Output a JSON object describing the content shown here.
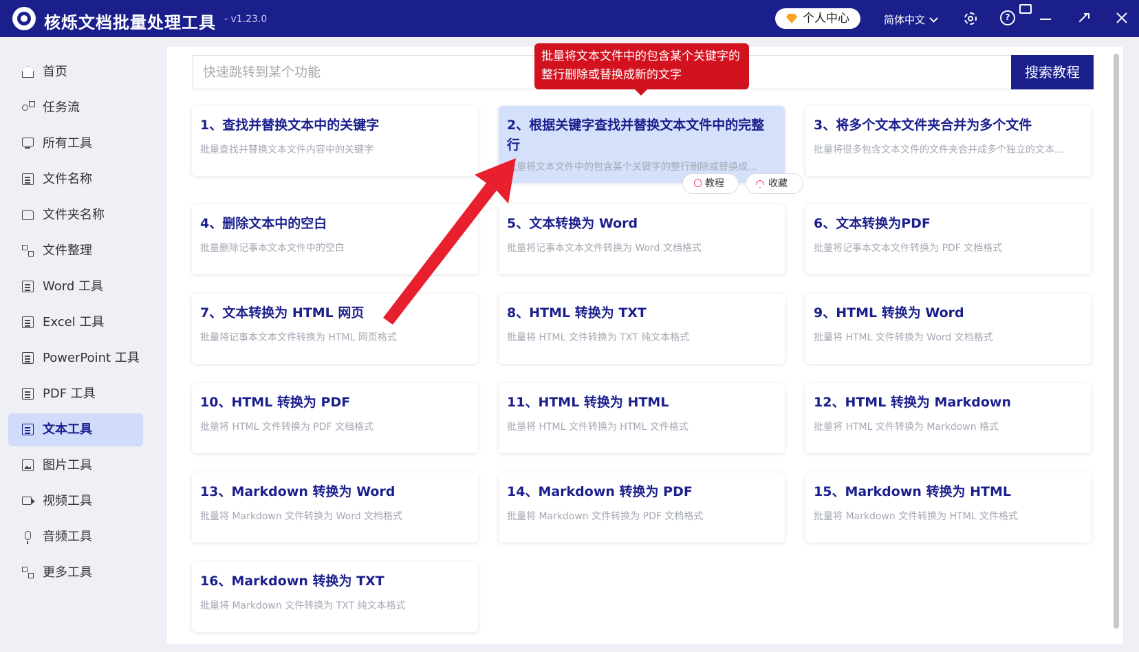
{
  "app": {
    "title": "核烁文档批量处理工具",
    "version": "- v1.23.0"
  },
  "titlebar": {
    "user_center": "个人中心",
    "language": "简体中文",
    "icons": [
      "vip-diamond-icon",
      "gear-icon",
      "help-icon",
      "feedback-icon",
      "minimize-icon",
      "maximize-icon",
      "close-icon"
    ]
  },
  "sidebar": {
    "items": [
      {
        "label": "首页",
        "icon": "home-icon"
      },
      {
        "label": "任务流",
        "icon": "flow-icon"
      },
      {
        "label": "所有工具",
        "icon": "monitor-icon"
      },
      {
        "label": "文件名称",
        "icon": "file-icon"
      },
      {
        "label": "文件夹名称",
        "icon": "folder-icon"
      },
      {
        "label": "文件整理",
        "icon": "organize-icon"
      },
      {
        "label": "Word 工具",
        "icon": "word-icon"
      },
      {
        "label": "Excel 工具",
        "icon": "excel-icon"
      },
      {
        "label": "PowerPoint 工具",
        "icon": "powerpoint-icon"
      },
      {
        "label": "PDF 工具",
        "icon": "pdf-icon"
      },
      {
        "label": "文本工具",
        "icon": "text-icon",
        "active": true
      },
      {
        "label": "图片工具",
        "icon": "image-icon"
      },
      {
        "label": "视频工具",
        "icon": "video-icon"
      },
      {
        "label": "音频工具",
        "icon": "audio-icon"
      },
      {
        "label": "更多工具",
        "icon": "grid-icon"
      }
    ]
  },
  "search": {
    "placeholder": "快速跳转到某个功能",
    "button": "搜索教程"
  },
  "tooltip": "批量将文本文件中的包含某个关键字的整行删除或替换成新的文字",
  "cards": [
    {
      "title": "1、查找并替换文本中的关键字",
      "desc": "批量查找并替换文本文件内容中的关键字"
    },
    {
      "title": "2、根据关键字查找并替换文本文件中的完整行",
      "desc": "批量将文本文件中的包含某个关键字的整行删除或替换成..."
    },
    {
      "title": "3、将多个文本文件夹合并为多个文件",
      "desc": "批量将很多包含文本文件的文件夹合并成多个独立的文本..."
    },
    {
      "title": "4、删除文本中的空白",
      "desc": "批量删除记事本文本文件中的空白"
    },
    {
      "title": "5、文本转换为 Word",
      "desc": "批量将记事本文本文件转换为 Word 文档格式"
    },
    {
      "title": "6、文本转换为PDF",
      "desc": "批量将记事本文本文件转换为 PDF 文档格式"
    },
    {
      "title": "7、文本转换为 HTML 网页",
      "desc": "批量将记事本文本文件转换为 HTML 网页格式"
    },
    {
      "title": "8、HTML 转换为 TXT",
      "desc": "批量将 HTML 文件转换为 TXT 纯文本格式"
    },
    {
      "title": "9、HTML 转换为 Word",
      "desc": "批量将 HTML 文件转换为 Word 文档格式"
    },
    {
      "title": "10、HTML 转换为 PDF",
      "desc": "批量将 HTML 文件转换为 PDF 文档格式"
    },
    {
      "title": "11、HTML 转换为 HTML",
      "desc": "批量将 HTML 文件转换为 HTML 文件格式"
    },
    {
      "title": "12、HTML 转换为 Markdown",
      "desc": "批量将 HTML 文件转换为 Markdown 格式"
    },
    {
      "title": "13、Markdown 转换为 Word",
      "desc": "批量将 Markdown 文件转换为 Word 文档格式"
    },
    {
      "title": "14、Markdown 转换为 PDF",
      "desc": "批量将 Markdown 文件转换为 PDF 文档格式"
    },
    {
      "title": "15、Markdown 转换为 HTML",
      "desc": "批量将 Markdown 文件转换为 HTML 文件格式"
    },
    {
      "title": "16、Markdown 转换为 TXT",
      "desc": "批量将 Markdown 文件转换为 TXT 纯文本格式"
    }
  ],
  "card_actions": {
    "tutorial": "教程",
    "favorite": "收藏"
  },
  "colors": {
    "titlebar": "#1a1f8c",
    "accent": "#1a1f8c",
    "active_nav": "#d0dcfa",
    "tooltip": "#d2121f",
    "arrow": "#e8202e"
  }
}
